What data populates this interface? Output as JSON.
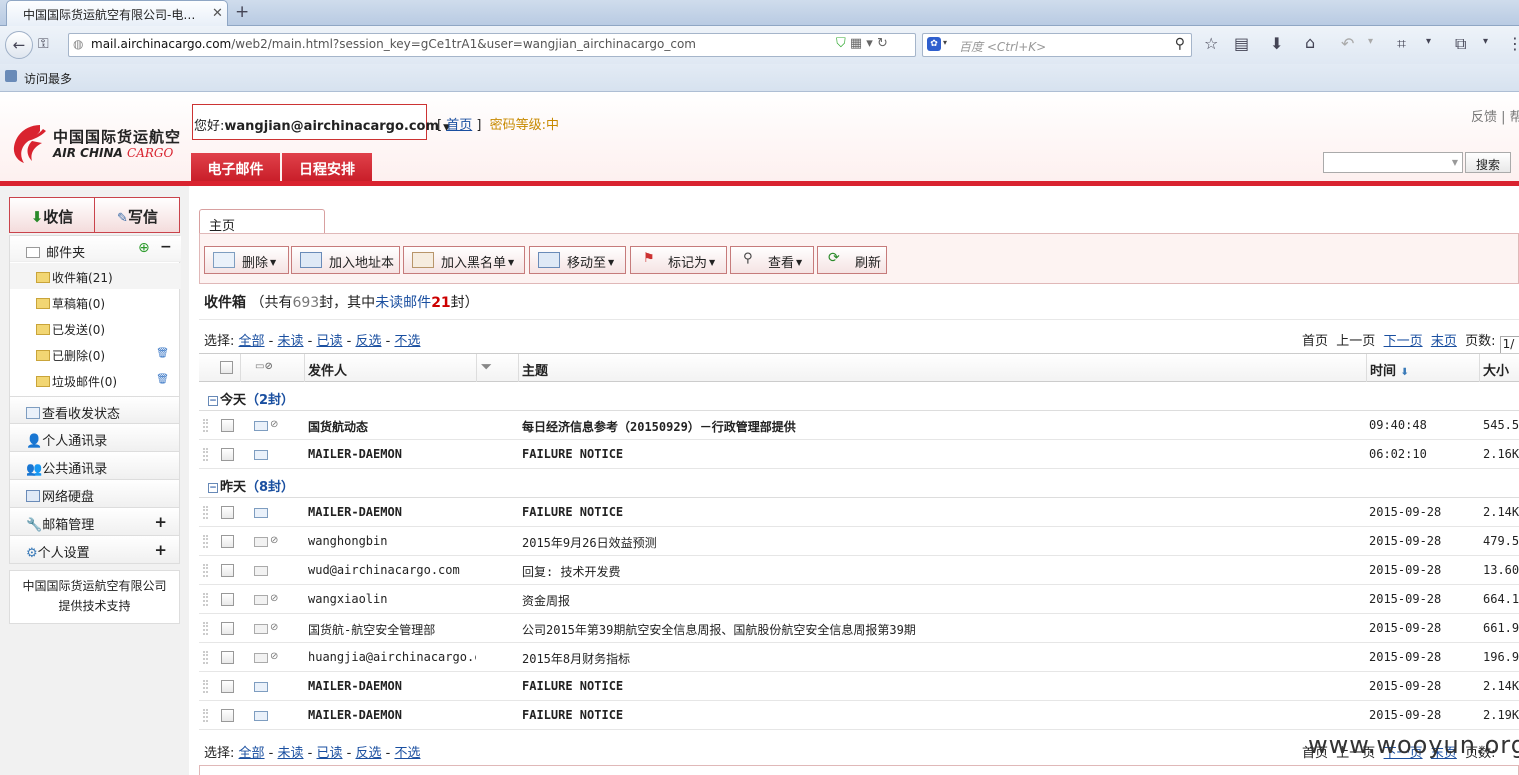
{
  "browser": {
    "tab_title": "中国国际货运航空有限公司-电…",
    "url_domain": "mail.airchinacargo.com",
    "url_rest": "/web2/main.html?session_key=gCe1trA1&user=wangjian_airchinacargo_com",
    "search_placeholder": "百度 <Ctrl+K>",
    "bookmark_label": "访问最多"
  },
  "header": {
    "logo_cn": "中国国际货运航空",
    "logo_en_1": "AIR CHINA",
    "logo_en_2": "CARGO",
    "greeting": "您好:",
    "user_email": "wangjian@airchinacargo.com",
    "bracket_open": "[",
    "home_link": "首页",
    "bracket_close": "]",
    "password_level": "密码等级:中",
    "feedback": "反馈 | 帮",
    "tabs": [
      "电子邮件",
      "日程安排"
    ],
    "search_button": "搜索"
  },
  "sidebar": {
    "receive": "收信",
    "compose": "写信",
    "folder_header": "邮件夹",
    "folders": [
      {
        "name": "收件箱",
        "count": "(21)"
      },
      {
        "name": "草稿箱",
        "count": "(0)"
      },
      {
        "name": "已发送",
        "count": "(0)"
      },
      {
        "name": "已删除",
        "count": "(0)"
      },
      {
        "name": "垃圾邮件",
        "count": "(0)"
      }
    ],
    "nav": [
      "查看收发状态",
      "个人通讯录",
      "公共通讯录",
      "网络硬盘",
      "邮箱管理",
      "个人设置"
    ],
    "support_line1": "中国国际货运航空有限公司",
    "support_line2": "提供技术支持"
  },
  "content": {
    "tab": "主页",
    "toolbar": [
      "删除",
      "加入地址本",
      "加入黑名单",
      "移动至",
      "标记为",
      "查看",
      "刷新"
    ],
    "inbox_title": "收件箱",
    "inbox_info_1": "（共有",
    "total": "693",
    "inbox_info_2": "封，其中",
    "unread_label": "未读邮件",
    "unread": "21",
    "inbox_info_3": "封）",
    "select_label": "选择:",
    "select_options": [
      "全部",
      "未读",
      "已读",
      "反选",
      "不选"
    ],
    "pager": {
      "first": "首页",
      "prev": "上一页",
      "next": "下一页",
      "last": "末页",
      "pages_label": "页数:",
      "page_value": "1/"
    },
    "columns": {
      "sender": "发件人",
      "subject": "主题",
      "time": "时间",
      "size": "大小"
    },
    "groups": [
      {
        "label": "今天",
        "count": "（2封）"
      },
      {
        "label": "昨天",
        "count": "（8封）"
      }
    ],
    "today_rows": [
      {
        "from": "国货航动态",
        "subject": "每日经济信息参考（20150929）－行政管理部提供",
        "time": "09:40:48",
        "size": "545.5",
        "unread": true,
        "attach": true
      },
      {
        "from": "MAILER-DAEMON",
        "subject": "FAILURE NOTICE",
        "time": "06:02:10",
        "size": "2.16K",
        "unread": true,
        "attach": false
      }
    ],
    "yesterday_rows": [
      {
        "from": "MAILER-DAEMON",
        "subject": "FAILURE NOTICE",
        "time": "2015-09-28",
        "size": "2.14K",
        "unread": true,
        "attach": false
      },
      {
        "from": "wanghongbin",
        "subject": "2015年9月26日效益预测",
        "time": "2015-09-28",
        "size": "479.5",
        "unread": false,
        "attach": true
      },
      {
        "from": "wud@airchinacargo.com",
        "subject": "回复: 技术开发费",
        "time": "2015-09-28",
        "size": "13.60",
        "unread": false,
        "attach": false
      },
      {
        "from": "wangxiaolin",
        "subject": "资金周报",
        "time": "2015-09-28",
        "size": "664.1",
        "unread": false,
        "attach": true
      },
      {
        "from": "国货航-航空安全管理部",
        "subject": "公司2015年第39期航空安全信息周报、国航股份航空安全信息周报第39期",
        "time": "2015-09-28",
        "size": "661.9",
        "unread": false,
        "attach": true
      },
      {
        "from": "huangjia@airchinacargo.com",
        "subject": "2015年8月财务指标",
        "time": "2015-09-28",
        "size": "196.9",
        "unread": false,
        "attach": true
      },
      {
        "from": "MAILER-DAEMON",
        "subject": "FAILURE NOTICE",
        "time": "2015-09-28",
        "size": "2.14K",
        "unread": true,
        "attach": false
      },
      {
        "from": "MAILER-DAEMON",
        "subject": "FAILURE NOTICE",
        "time": "2015-09-28",
        "size": "2.19K",
        "unread": true,
        "attach": false
      }
    ]
  },
  "watermark": "www.wooyun.org"
}
